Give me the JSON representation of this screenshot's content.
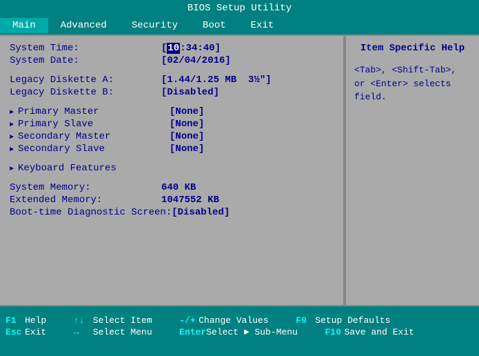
{
  "title": "BIOS Setup Utility",
  "menu": {
    "items": [
      {
        "label": "Main",
        "active": true
      },
      {
        "label": "Advanced",
        "active": false
      },
      {
        "label": "Security",
        "active": false
      },
      {
        "label": "Boot",
        "active": false
      },
      {
        "label": "Exit",
        "active": false
      }
    ]
  },
  "left_panel": {
    "fields": [
      {
        "label": "System Time:",
        "value": "[10:34:40]",
        "highlight_char": "10"
      },
      {
        "label": "System Date:",
        "value": "[02/04/2016]"
      },
      {
        "label": "",
        "value": ""
      },
      {
        "label": "Legacy Diskette A:",
        "value": "[1.44/1.25 MB  3½\"]"
      },
      {
        "label": "Legacy Diskette B:",
        "value": "[Disabled]"
      }
    ],
    "nav_items": [
      {
        "label": "Primary Master",
        "value": "[None]"
      },
      {
        "label": "Primary Slave",
        "value": "[None]"
      },
      {
        "label": "Secondary Master",
        "value": "[None]"
      },
      {
        "label": "Secondary Slave",
        "value": "[None]"
      }
    ],
    "submenu_items": [
      {
        "label": "Keyboard Features"
      }
    ],
    "memory_fields": [
      {
        "label": "System Memory:",
        "value": "640 KB"
      },
      {
        "label": "Extended Memory:",
        "value": "1047552 KB"
      },
      {
        "label": "Boot-time Diagnostic Screen:",
        "value": "[Disabled]"
      }
    ]
  },
  "right_panel": {
    "title": "Item Specific Help",
    "help_text": "<Tab>, <Shift-Tab>, or <Enter> selects field."
  },
  "status_bar": {
    "rows": [
      [
        {
          "key": "F1",
          "desc": "Help"
        },
        {
          "key": "↑↓",
          "desc": "Select Item"
        },
        {
          "key": "-/+",
          "desc": "Change Values"
        },
        {
          "key": "F9",
          "desc": "Setup Defaults"
        }
      ],
      [
        {
          "key": "Esc",
          "desc": "Exit"
        },
        {
          "key": "↔",
          "desc": "Select Menu"
        },
        {
          "key": "Enter",
          "desc": "Select ► Sub-Menu"
        },
        {
          "key": "F10",
          "desc": "Save and Exit"
        }
      ]
    ]
  }
}
